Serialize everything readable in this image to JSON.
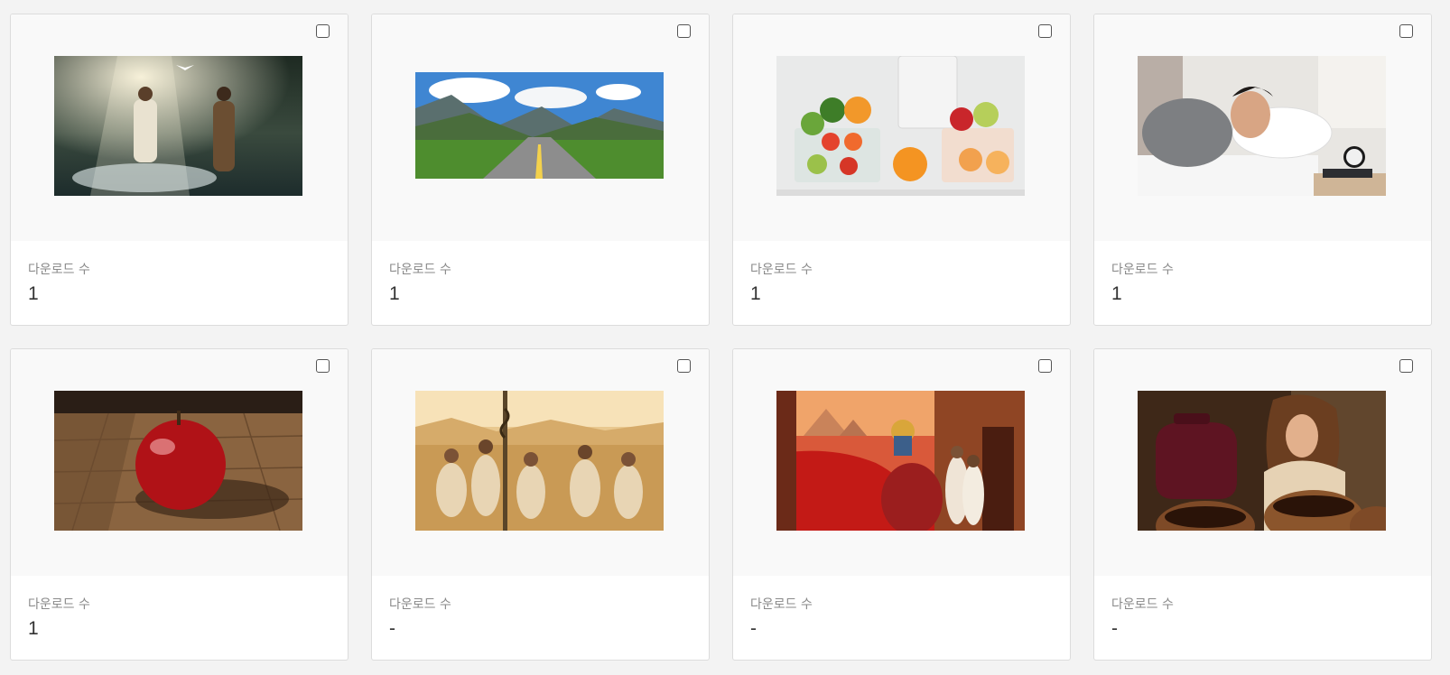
{
  "cards": [
    {
      "download_label": "다운로드 수",
      "download_count": "1",
      "thumb_icon": "baptism-river-image"
    },
    {
      "download_label": "다운로드 수",
      "download_count": "1",
      "thumb_icon": "mountain-road-image"
    },
    {
      "download_label": "다운로드 수",
      "download_count": "1",
      "thumb_icon": "fridge-fruits-image"
    },
    {
      "download_label": "다운로드 수",
      "download_count": "1",
      "thumb_icon": "sleeping-man-image"
    },
    {
      "download_label": "다운로드 수",
      "download_count": "1",
      "thumb_icon": "red-apple-image"
    },
    {
      "download_label": "다운로드 수",
      "download_count": "-",
      "thumb_icon": "praying-desert-image"
    },
    {
      "download_label": "다운로드 수",
      "download_count": "-",
      "thumb_icon": "red-river-pharaoh-image"
    },
    {
      "download_label": "다운로드 수",
      "download_count": "-",
      "thumb_icon": "woman-jars-image"
    }
  ]
}
